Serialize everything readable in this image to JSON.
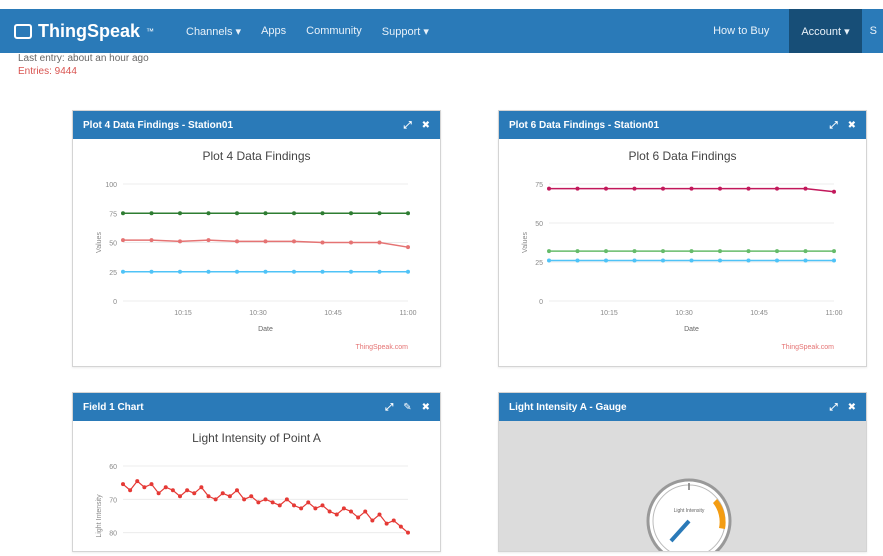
{
  "navbar": {
    "brand": "ThingSpeak",
    "tm": "™",
    "links": [
      "Channels ▾",
      "Apps",
      "Community",
      "Support ▾"
    ],
    "how_to_buy": "How to Buy",
    "account": "Account ▾",
    "sign": "S"
  },
  "channel_info": {
    "last_entry": "Last entry:  about an hour ago",
    "entries": "Entries: 9444"
  },
  "panels": [
    {
      "title": "Plot 4 Data Findings - Station01",
      "tools": [
        "⤢",
        "✖"
      ]
    },
    {
      "title": "Plot 6 Data Findings - Station01",
      "tools": [
        "⤢",
        "✖"
      ]
    },
    {
      "title": "Field 1 Chart",
      "tools": [
        "⤢",
        "✎",
        "✖"
      ]
    },
    {
      "title": "Light Intensity A - Gauge",
      "tools": [
        "⤢",
        "✖"
      ]
    }
  ],
  "chart_data": [
    {
      "type": "line",
      "title": "Plot 4 Data Findings",
      "xlabel": "Date",
      "ylabel": "Values",
      "x": [
        "10:15",
        "10:30",
        "10:45",
        "11:00"
      ],
      "yticks": [
        "0",
        "25",
        "50",
        "75",
        "100"
      ],
      "ylim": [
        0,
        100
      ],
      "credit": "ThingSpeak.com",
      "series": [
        {
          "color": "#2e7d32",
          "values": [
            75,
            75,
            75,
            75,
            75,
            75,
            75,
            75,
            75,
            75,
            75
          ]
        },
        {
          "color": "#e57373",
          "values": [
            52,
            52,
            51,
            52,
            51,
            51,
            51,
            50,
            50,
            50,
            46
          ]
        },
        {
          "color": "#4fc3f7",
          "values": [
            25,
            25,
            25,
            25,
            25,
            25,
            25,
            25,
            25,
            25,
            25
          ]
        }
      ]
    },
    {
      "type": "line",
      "title": "Plot 6 Data Findings",
      "xlabel": "Date",
      "ylabel": "Values",
      "x": [
        "10:15",
        "10:30",
        "10:45",
        "11:00"
      ],
      "yticks": [
        "0",
        "25",
        "50",
        "75"
      ],
      "ylim": [
        0,
        75
      ],
      "credit": "ThingSpeak.com",
      "series": [
        {
          "color": "#c2185b",
          "values": [
            72,
            72,
            72,
            72,
            72,
            72,
            72,
            72,
            72,
            72,
            70
          ]
        },
        {
          "color": "#66bb6a",
          "values": [
            32,
            32,
            32,
            32,
            32,
            32,
            32,
            32,
            32,
            32,
            32
          ]
        },
        {
          "color": "#4fc3f7",
          "values": [
            26,
            26,
            26,
            26,
            26,
            26,
            26,
            26,
            26,
            26,
            26
          ]
        }
      ]
    },
    {
      "type": "line",
      "title": "Light Intensity of Point A",
      "ylabel": "Light Intensity",
      "yticks": [
        "",
        "80",
        "70",
        "60"
      ],
      "series": [
        {
          "color": "#e53935",
          "values": [
            82,
            80,
            83,
            81,
            82,
            79,
            81,
            80,
            78,
            80,
            79,
            81,
            78,
            77,
            79,
            78,
            80,
            77,
            78,
            76,
            77,
            76,
            75,
            77,
            75,
            74,
            76,
            74,
            75,
            73,
            72,
            74,
            73,
            71,
            73,
            70,
            72,
            69,
            70,
            68,
            66
          ]
        }
      ]
    }
  ],
  "gauge": {
    "label": "Light Intensity",
    "accent": "#f39c12"
  }
}
